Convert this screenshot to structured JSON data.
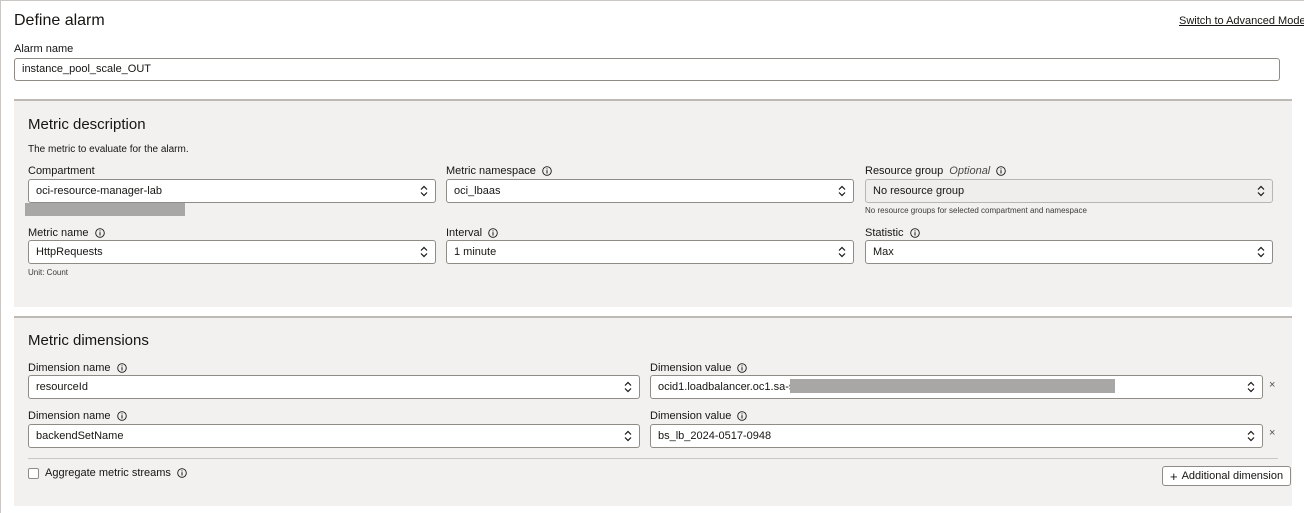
{
  "header": {
    "title": "Define alarm",
    "advanced_link": "Switch to Advanced Mode"
  },
  "alarm_name": {
    "label": "Alarm name",
    "value": "instance_pool_scale_OUT"
  },
  "metric_description": {
    "title": "Metric description",
    "description": "The metric to evaluate for the alarm.",
    "compartment": {
      "label": "Compartment",
      "value": "oci-resource-manager-lab"
    },
    "namespace": {
      "label": "Metric namespace",
      "value": "oci_lbaas"
    },
    "resource_group": {
      "label": "Resource group",
      "optional": "Optional",
      "value": "No resource group",
      "hint": "No resource groups for selected compartment and namespace"
    },
    "metric_name": {
      "label": "Metric name",
      "value": "HttpRequests",
      "unit": "Unit: Count"
    },
    "interval": {
      "label": "Interval",
      "value": "1 minute"
    },
    "statistic": {
      "label": "Statistic",
      "value": "Max"
    }
  },
  "metric_dimensions": {
    "title": "Metric dimensions",
    "rows": [
      {
        "name_label": "Dimension name",
        "name_value": "resourceId",
        "value_label": "Dimension value",
        "value_value": "ocid1.loadbalancer.oc1.sa-saop"
      },
      {
        "name_label": "Dimension name",
        "name_value": "backendSetName",
        "value_label": "Dimension value",
        "value_value": "bs_lb_2024-0517-0948"
      }
    ],
    "aggregate_label": "Aggregate metric streams",
    "add_button": "Additional dimension",
    "remove_symbol": "×",
    "plus_symbol": "+"
  }
}
